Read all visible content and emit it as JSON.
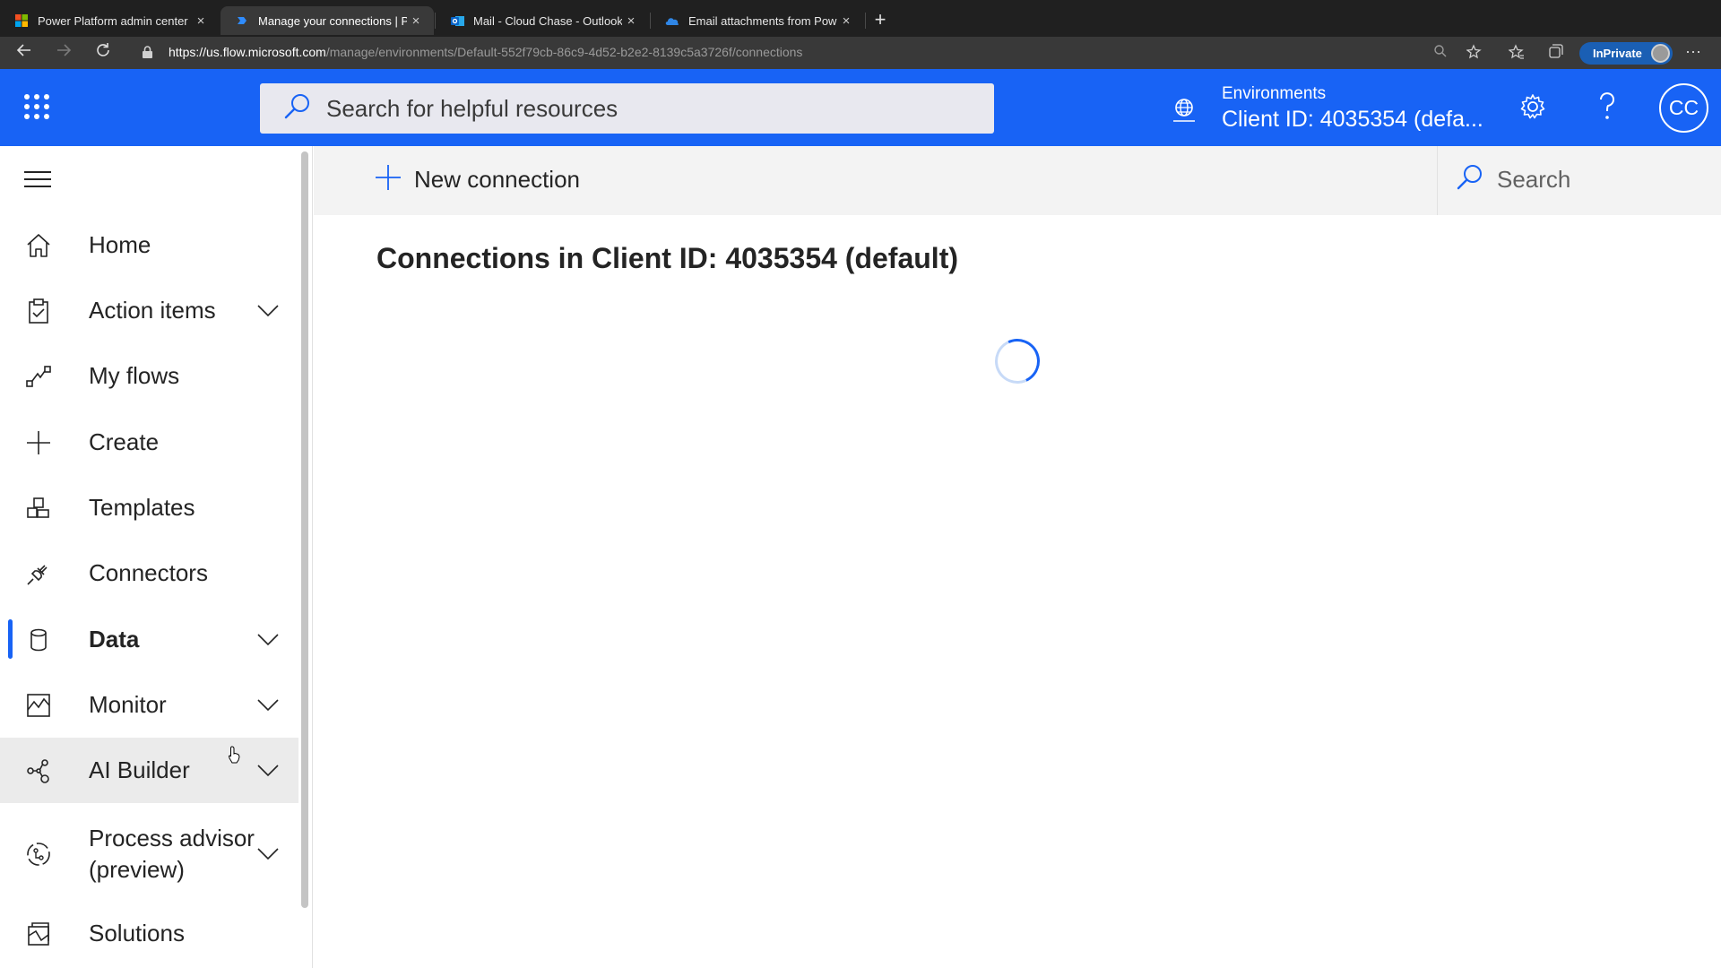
{
  "browser": {
    "tabs": [
      {
        "title": "Power Platform admin center",
        "icon": "microsoft-logo-icon",
        "active": false
      },
      {
        "title": "Manage your connections | Po",
        "icon": "power-automate-icon",
        "active": true
      },
      {
        "title": "Mail - Cloud Chase - Outlook",
        "icon": "outlook-icon",
        "active": false
      },
      {
        "title": "Email attachments from Power",
        "icon": "onedrive-icon",
        "active": false
      }
    ],
    "url_host": "https://us.flow.microsoft.com",
    "url_path": "/manage/environments/Default-552f79cb-86c9-4d52-b2e2-8139c5a3726f/connections",
    "inprivate_label": "InPrivate"
  },
  "header": {
    "search_placeholder": "Search for helpful resources",
    "environment_label": "Environments",
    "environment_value": "Client ID: 4035354 (defa...",
    "avatar_initials": "CC"
  },
  "sidebar": {
    "items": [
      {
        "label": "Home",
        "icon": "home-icon",
        "expandable": false
      },
      {
        "label": "Action items",
        "icon": "clipboard-icon",
        "expandable": true
      },
      {
        "label": "My flows",
        "icon": "flow-icon",
        "expandable": false
      },
      {
        "label": "Create",
        "icon": "plus-icon",
        "expandable": false
      },
      {
        "label": "Templates",
        "icon": "templates-icon",
        "expandable": false
      },
      {
        "label": "Connectors",
        "icon": "plug-icon",
        "expandable": false
      },
      {
        "label": "Data",
        "icon": "database-icon",
        "expandable": true,
        "selected": true
      },
      {
        "label": "Monitor",
        "icon": "monitor-icon",
        "expandable": true
      },
      {
        "label": "AI Builder",
        "icon": "ai-builder-icon",
        "expandable": true,
        "hovered": true
      },
      {
        "label": "Process advisor (preview)",
        "icon": "process-advisor-icon",
        "expandable": true
      },
      {
        "label": "Solutions",
        "icon": "solutions-icon",
        "expandable": false
      }
    ]
  },
  "main": {
    "new_connection_label": "New connection",
    "search_label": "Search",
    "title": "Connections in Client ID: 4035354 (default)",
    "loading": true
  },
  "colors": {
    "brand_blue": "#1863f5",
    "chrome_dark": "#202020",
    "chrome_mid": "#393939",
    "command_bar": "#f3f3f3"
  }
}
